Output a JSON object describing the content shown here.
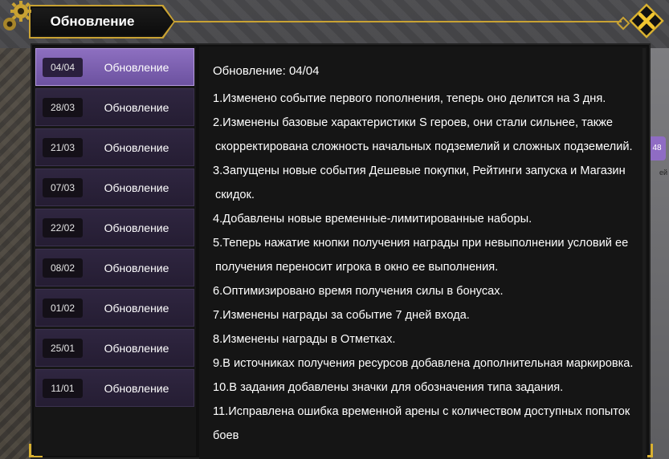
{
  "header": {
    "title": "Обновление",
    "close_icon": "close-icon",
    "gear_icon": "gear-icon"
  },
  "sidebar": {
    "items": [
      {
        "date": "04/04",
        "label": "Обновление",
        "active": true
      },
      {
        "date": "28/03",
        "label": "Обновление",
        "active": false
      },
      {
        "date": "21/03",
        "label": "Обновление",
        "active": false
      },
      {
        "date": "07/03",
        "label": "Обновление",
        "active": false
      },
      {
        "date": "22/02",
        "label": "Обновление",
        "active": false
      },
      {
        "date": "08/02",
        "label": "Обновление",
        "active": false
      },
      {
        "date": "01/02",
        "label": "Обновление",
        "active": false
      },
      {
        "date": "25/01",
        "label": "Обновление",
        "active": false
      },
      {
        "date": "11/01",
        "label": "Обновление",
        "active": false
      }
    ]
  },
  "content": {
    "title": "Обновление: 04/04",
    "lines": [
      "1.Изменено событие первого пополнения, теперь оно делится на 3 дня.",
      "2.Изменены базовые характеристики S героев, они стали сильнее, также",
      " скорректирована сложность начальных подземелий и сложных подземелий.",
      "3.Запущены новые события Дешевые покупки, Рейтинги запуска и Магазин",
      " скидок.",
      "4.Добавлены новые временные-лимитированные наборы.",
      "5.Теперь нажатие кнопки получения награды при невыполнении условий ее",
      " получения переносит игрока в окно ее выполнения.",
      "6.Оптимизировано время получения силы в бонусах.",
      "7.Изменены награды за событие 7 дней входа.",
      "8.Изменены награды в Отметках.",
      "9.В источниках получения ресурсов добавлена дополнительная маркировка.",
      "10.В задания добавлены значки для обозначения типа задания.",
      "11.Исправлена ошибка временной арены с количеством доступных попыток",
      "боев"
    ]
  },
  "background": {
    "badge_text": "48",
    "side_text": "ей"
  },
  "colors": {
    "accent_gold": "#c9a233",
    "active_item": "#8d6fc0",
    "inactive_item": "#2f2640"
  }
}
